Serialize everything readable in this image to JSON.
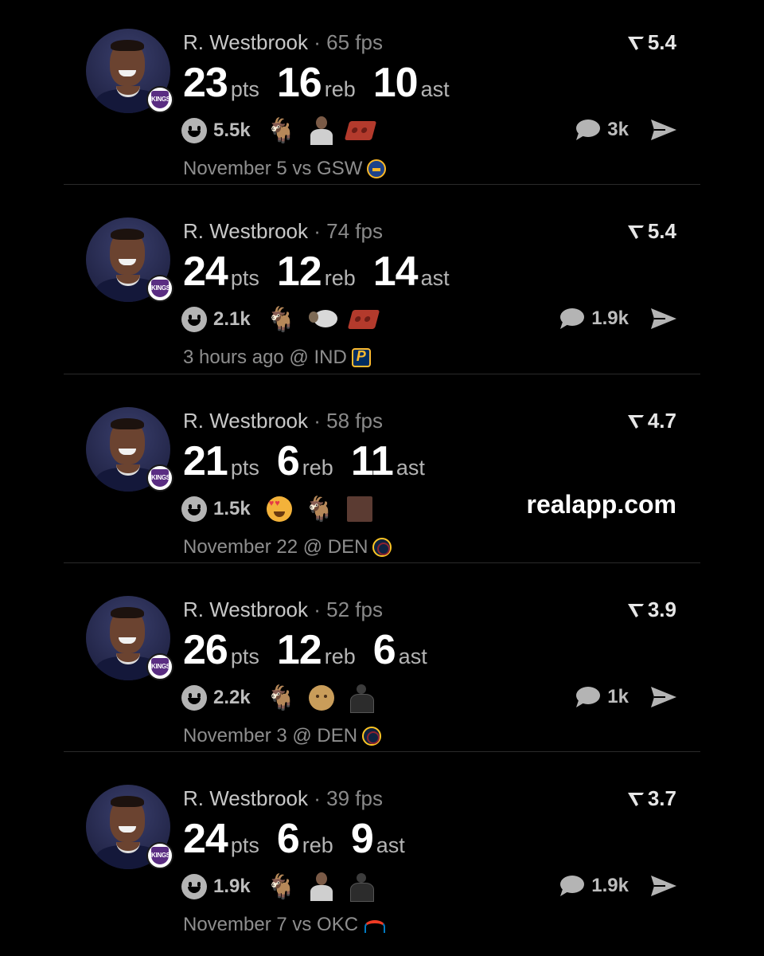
{
  "colors": {
    "background": "#000000",
    "text_primary": "#ffffff",
    "text_muted": "#8e8e8e"
  },
  "posts": [
    {
      "player_name": "R. Westbrook",
      "fps": "· 65 fps",
      "rating": "5.4",
      "stats": [
        {
          "value": "23",
          "unit": "pts"
        },
        {
          "value": "16",
          "unit": "reb"
        },
        {
          "value": "10",
          "unit": "ast"
        }
      ],
      "reaction_count": "5.5k",
      "reactions": [
        "goat",
        "player-thumb",
        "brick"
      ],
      "comment_count": "3k",
      "game": "November 5 vs GSW",
      "opponent_logo": "gsw"
    },
    {
      "player_name": "R. Westbrook",
      "fps": "· 74 fps",
      "rating": "5.4",
      "stats": [
        {
          "value": "24",
          "unit": "pts"
        },
        {
          "value": "12",
          "unit": "reb"
        },
        {
          "value": "14",
          "unit": "ast"
        }
      ],
      "reaction_count": "2.1k",
      "reactions": [
        "goat",
        "sheep",
        "brick"
      ],
      "comment_count": "1.9k",
      "game": "3 hours ago @ IND",
      "opponent_logo": "ind"
    },
    {
      "player_name": "R. Westbrook",
      "fps": "· 58 fps",
      "rating": "4.7",
      "stats": [
        {
          "value": "21",
          "unit": "pts"
        },
        {
          "value": "6",
          "unit": "reb"
        },
        {
          "value": "11",
          "unit": "ast"
        }
      ],
      "reaction_count": "1.5k",
      "reactions": [
        "love",
        "goat",
        "photo"
      ],
      "watermark": "realapp.com",
      "game": "November 22 @ DEN",
      "opponent_logo": "den"
    },
    {
      "player_name": "R. Westbrook",
      "fps": "· 52 fps",
      "rating": "3.9",
      "stats": [
        {
          "value": "26",
          "unit": "pts"
        },
        {
          "value": "12",
          "unit": "reb"
        },
        {
          "value": "6",
          "unit": "ast"
        }
      ],
      "reaction_count": "2.2k",
      "reactions": [
        "goat",
        "bald",
        "jersey"
      ],
      "comment_count": "1k",
      "game": "November 3 @ DEN",
      "opponent_logo": "den"
    },
    {
      "player_name": "R. Westbrook",
      "fps": "· 39 fps",
      "rating": "3.7",
      "stats": [
        {
          "value": "24",
          "unit": "pts"
        },
        {
          "value": "6",
          "unit": "reb"
        },
        {
          "value": "9",
          "unit": "ast"
        }
      ],
      "reaction_count": "1.9k",
      "reactions": [
        "goat",
        "player-thumb",
        "jersey"
      ],
      "comment_count": "1.9k",
      "game": "November 7 vs OKC",
      "opponent_logo": "okc"
    }
  ],
  "badge_text": "KINGS"
}
